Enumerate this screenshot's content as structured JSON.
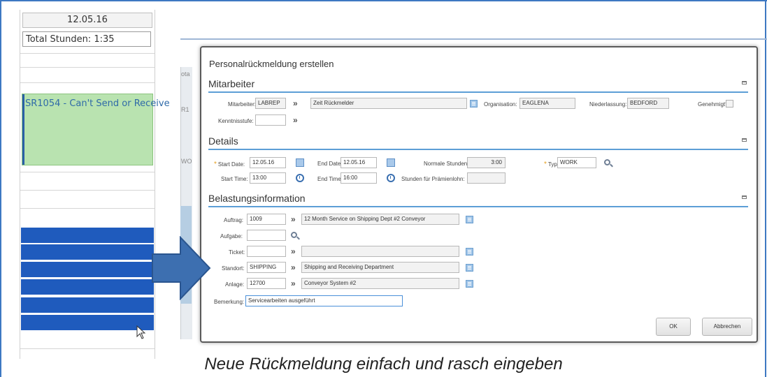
{
  "calendar": {
    "date": "12.05.16",
    "total": "Total Stunden: 1:35",
    "event": "SR1054 - Can't Send or Receive"
  },
  "background": {
    "frag_ota": "ota",
    "frag_r1": "R1",
    "frag_wo": "WO"
  },
  "dialog": {
    "title": "Personalrückmeldung erstellen",
    "mitarbeiter": {
      "title": "Mitarbeiter",
      "mitarbeiter_label": "Mitarbeiter:",
      "mitarbeiter_value": "LABREP",
      "mitarbeiter_desc": "Zeit Rückmelder",
      "organisation_label": "Organisation:",
      "organisation_value": "EAGLENA",
      "niederlassung_label": "Niederlassung:",
      "niederlassung_value": "BEDFORD",
      "genehmigt_label": "Genehmigt?",
      "kenntnisstufe_label": "Kenntnisstufe:",
      "kenntnisstufe_value": ""
    },
    "details": {
      "title": "Details",
      "start_date_label": "Start Date:",
      "start_date_value": "12.05.16",
      "end_date_label": "End Date:",
      "end_date_value": "12.05.16",
      "normale_label": "Normale Stunden:",
      "normale_value": "3:00",
      "typ_label": "Typ:",
      "typ_value": "WORK",
      "start_time_label": "Start Time:",
      "start_time_value": "13:00",
      "end_time_label": "End Time:",
      "end_time_value": "16:00",
      "praemie_label": "Stunden für Prämienlohn:",
      "praemie_value": ""
    },
    "belastung": {
      "title": "Belastungsinformation",
      "auftrag_label": "Auftrag:",
      "auftrag_value": "1009",
      "auftrag_desc": "12 Month Service on Shipping Dept #2 Conveyor",
      "aufgabe_label": "Aufgabe:",
      "aufgabe_value": "",
      "ticket_label": "Ticket:",
      "ticket_value": "",
      "ticket_desc": "",
      "standort_label": "Standort:",
      "standort_value": "SHIPPING",
      "standort_desc": "Shipping and Receiving Department",
      "anlage_label": "Anlage:",
      "anlage_value": "12700",
      "anlage_desc": "Conveyor System #2",
      "bemerkung_label": "Bemerkung:",
      "bemerkung_value": "Servicearbeiten ausgeführt"
    },
    "buttons": {
      "ok": "OK",
      "cancel": "Abbrechen"
    }
  },
  "caption": "Neue Rückmeldung einfach und rasch eingeben",
  "colors": {
    "arrow": "#3d6fb0",
    "section_line": "#5c9ed6",
    "calendar_event": "#b9e3b0",
    "calendar_block": "#1f5bbd",
    "frame": "#3d78c2"
  }
}
